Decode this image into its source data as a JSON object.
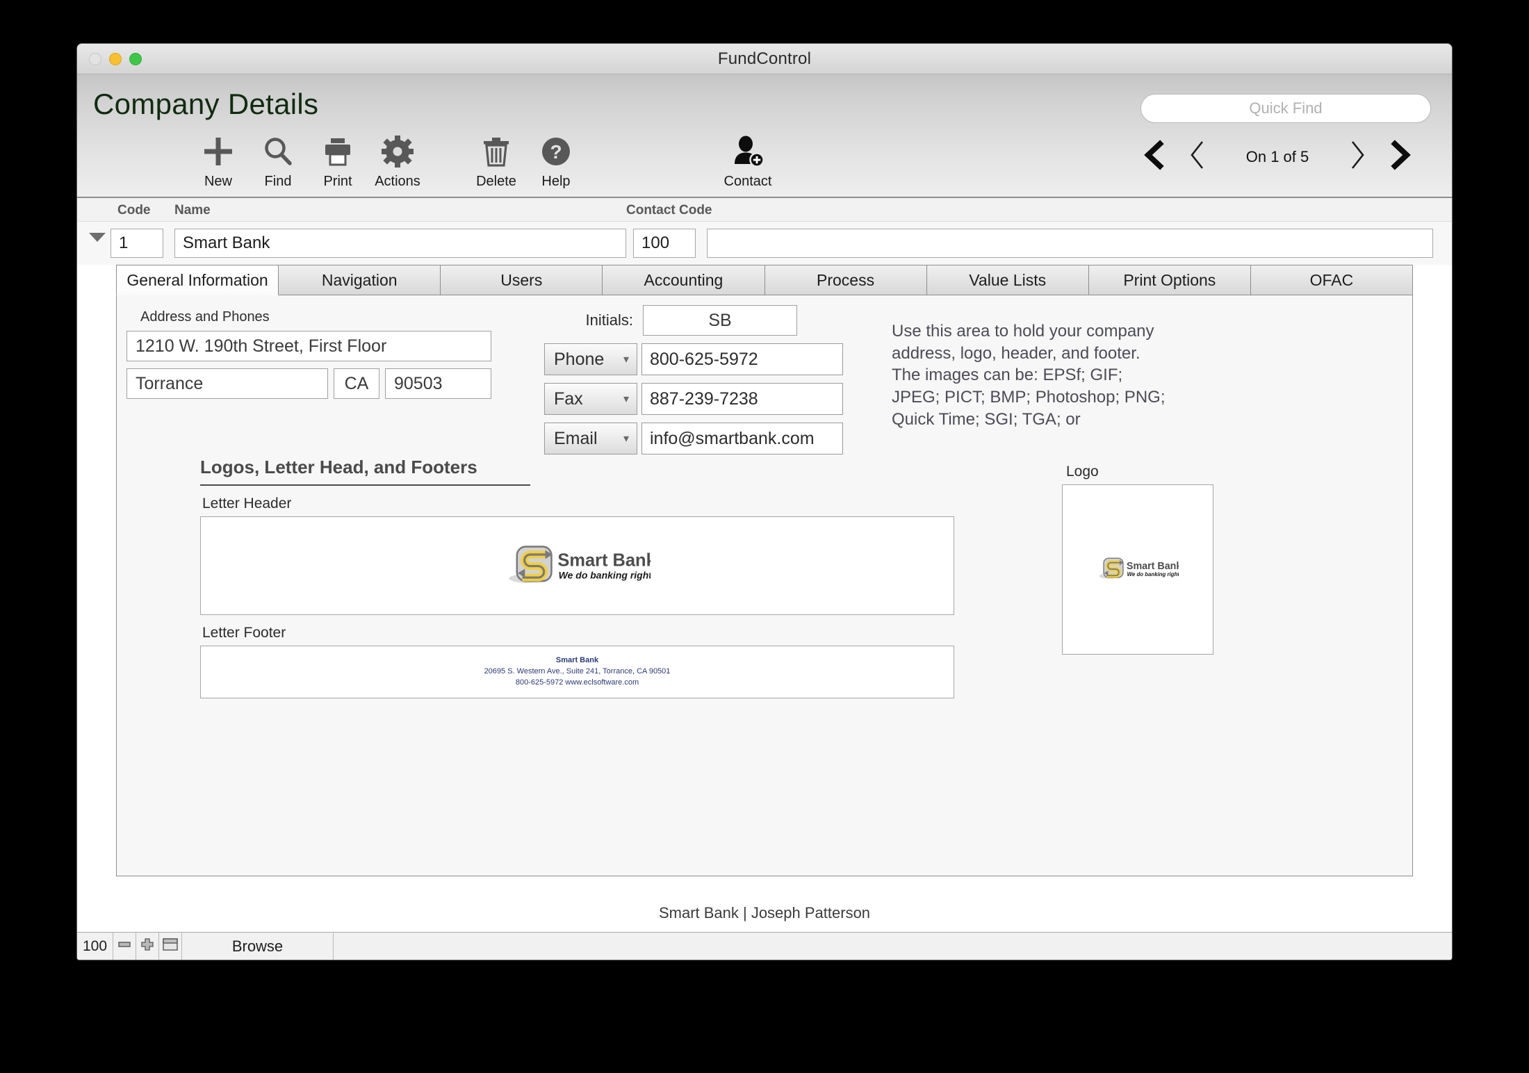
{
  "window": {
    "title": "FundControl",
    "traffic_lights": [
      "close",
      "minimize",
      "maximize"
    ]
  },
  "header": {
    "page_title": "Company Details",
    "quick_find_placeholder": "Quick Find"
  },
  "toolbar": {
    "buttons": [
      {
        "label": "New",
        "icon": "plus-icon"
      },
      {
        "label": "Find",
        "icon": "magnifier-icon"
      },
      {
        "label": "Print",
        "icon": "printer-icon"
      },
      {
        "label": "Actions",
        "icon": "gear-icon"
      },
      {
        "label": "Delete",
        "icon": "trash-icon"
      },
      {
        "label": "Help",
        "icon": "question-circle-icon"
      },
      {
        "label": "Contact",
        "icon": "person-add-icon"
      }
    ]
  },
  "navigation": {
    "first_label": "❮",
    "prev_label": "‹",
    "record_status": "On 1 of 5",
    "next_label": "›",
    "last_label": "❯"
  },
  "record_header": {
    "code_label": "Code",
    "name_label": "Name",
    "contact_code_label": "Contact Code"
  },
  "record": {
    "code": "1",
    "name": "Smart Bank",
    "contact_code": "100",
    "extra": ""
  },
  "tabs": [
    {
      "label": "General Information",
      "active": true
    },
    {
      "label": "Navigation",
      "active": false
    },
    {
      "label": "Users",
      "active": false
    },
    {
      "label": "Accounting",
      "active": false
    },
    {
      "label": "Process",
      "active": false
    },
    {
      "label": "Value Lists",
      "active": false
    },
    {
      "label": "Print Options",
      "active": false
    },
    {
      "label": "OFAC",
      "active": false
    }
  ],
  "general": {
    "address_section_label": "Address and Phones",
    "address1": "1210 W. 190th Street, First Floor",
    "city": "Torrance",
    "state": "CA",
    "zip": "90503",
    "initials_label": "Initials:",
    "initials": "SB",
    "contact_methods": [
      {
        "type": "Phone",
        "value": "800-625-5972"
      },
      {
        "type": "Fax",
        "value": "887-239-7238"
      },
      {
        "type": "Email",
        "value": "info@smartbank.com"
      }
    ],
    "help_text": "Use this area to hold your company address, logo, header, and footer. The images can be: EPSf; GIF; JPEG; PICT; BMP; Photoshop; PNG; Quick Time; SGI; TGA; or",
    "logos_section_title": "Logos, Letter Head, and Footers",
    "letter_header_label": "Letter Header",
    "letter_footer_label": "Letter Footer",
    "logo_label": "Logo",
    "brand": {
      "name": "Smart Bank",
      "tagline": "We do banking right!",
      "accent_yellow": "#f2cf3e",
      "accent_gray": "#7a7a7a"
    },
    "letter_footer": {
      "company": "Smart Bank",
      "address_line": "20695 S. Western Ave., Suite 241, Torrance, CA  90501",
      "contact_line": "800-625-5972  www.eclsoftware.com",
      "color": "#2b3a75"
    }
  },
  "status": {
    "account_line": "Smart Bank | Joseph Patterson",
    "zoom_level": "100",
    "zoom_out_icon": "minus-icon",
    "zoom_in_icon": "plus-icon",
    "layout_toggle_icon": "window-icon",
    "mode": "Browse"
  }
}
